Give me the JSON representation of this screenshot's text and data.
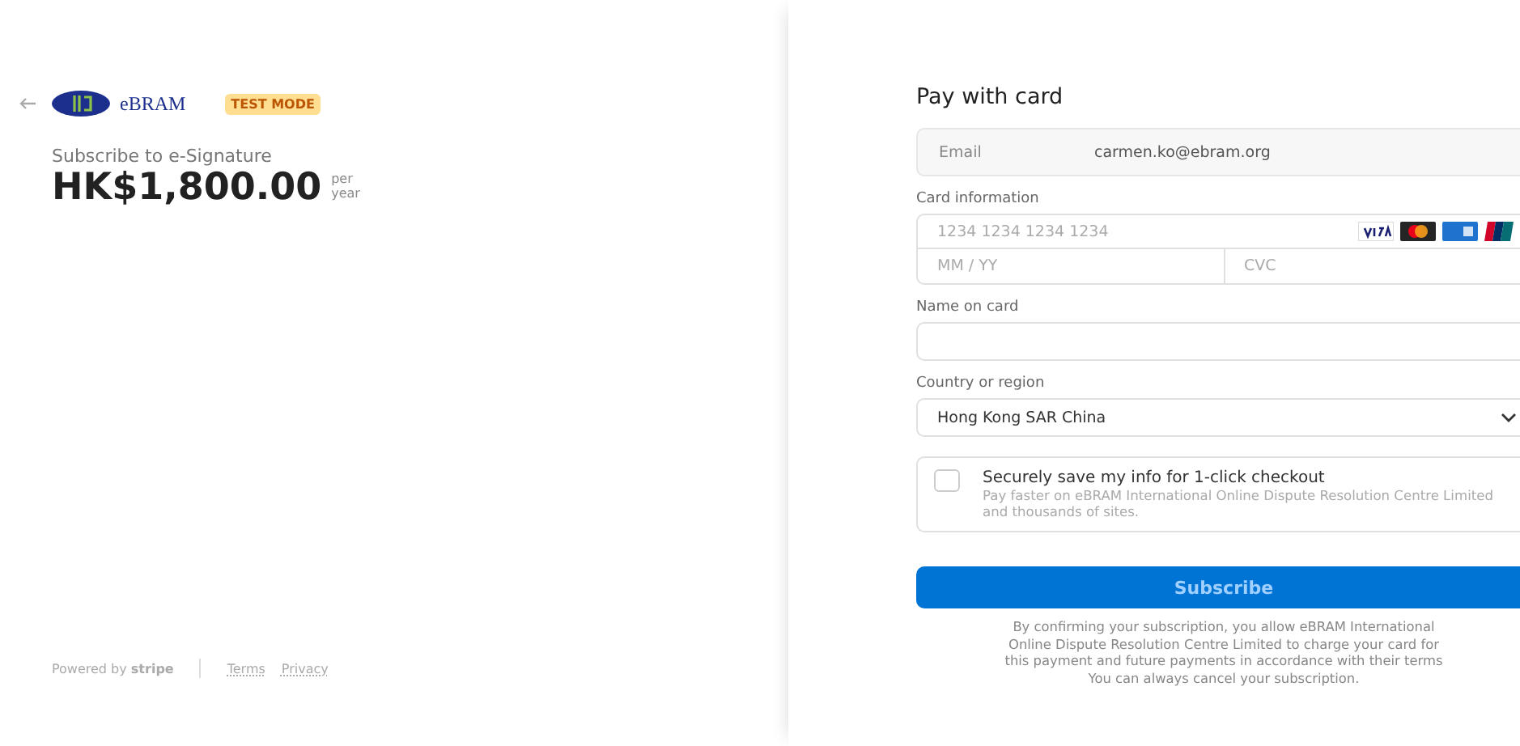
{
  "merchant": {
    "logo_text": "eBRAM",
    "badge": "TEST MODE"
  },
  "product": {
    "description": "Subscribe to e-Signature",
    "price": "HK$1,800.00",
    "period_top": "per",
    "period_bottom": "year"
  },
  "footer": {
    "powered": "Powered by **stripe**",
    "links": [
      "Terms",
      "Privacy"
    ]
  },
  "form": {
    "title": "Pay with card",
    "email": {
      "label": "Email",
      "value": "carmen.ko@ebram.org"
    },
    "card": {
      "label": "Card information",
      "number_placeholder": "1234 1234 1234 1234",
      "expiry_placeholder": "MM / YY",
      "cvc_placeholder": "CVC"
    },
    "name": {
      "label": "Name on card"
    },
    "country": {
      "label": "Country or region",
      "value": "Hong Kong SAR China"
    },
    "save_info": {
      "checked": false,
      "title": "Securely save my info for 1-click checkout",
      "detail": "Pay faster on eBRAM International Online Dispute Resolution Centre Limited and thousands of sites."
    },
    "submit": "Subscribe",
    "disclaimer": [
      "By confirming your subscription, you allow eBRAM International",
      "Online Dispute Resolution Centre Limited to charge your card for",
      "this payment and future payments in accordance with their terms",
      "You can always cancel your subscription."
    ]
  }
}
